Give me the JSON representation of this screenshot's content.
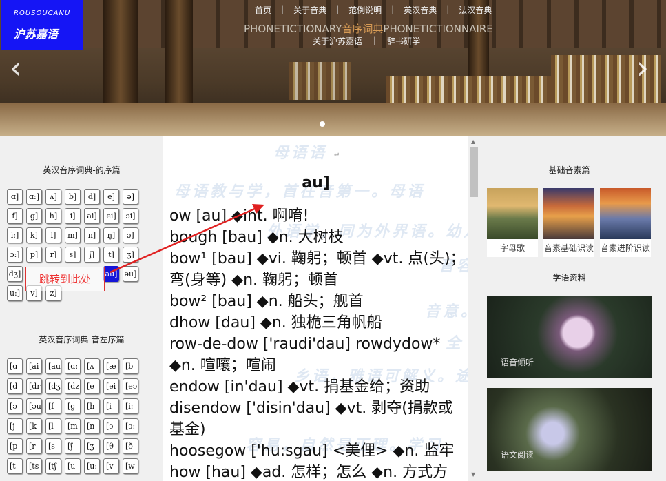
{
  "brand": {
    "en": "ROUSOUCANU",
    "cn": "沪苏嘉语"
  },
  "nav": {
    "items": [
      "首页",
      "关于音典",
      "范例说明",
      "英汉音典",
      "法汉音典"
    ],
    "separator": "|",
    "subtitle_left": "PHONETICTIONARY",
    "subtitle_mid": "音序词典",
    "subtitle_right": "PHONETICTIONNAIRE",
    "items2": [
      "关于沪苏嘉语",
      "|",
      "辞书研学"
    ]
  },
  "carousel": {
    "prev": "‹",
    "next": "›"
  },
  "left_panel": {
    "section1_title": "英汉音序词典-韵序篇",
    "rhyme_keys": [
      "ɑ]",
      "ɑ:]",
      "ʌ]",
      "b]",
      "d]",
      "e]",
      "ə]",
      "f]",
      "g]",
      "h]",
      "i]",
      "ai]",
      "ei]",
      "ɔi]",
      "i:]",
      "k]",
      "l]",
      "m]",
      "n]",
      "ŋ]",
      "ɔ]",
      "ɔ:]",
      "p]",
      "r]",
      "s]",
      "ʃ]",
      "t]",
      "ʒ]",
      "dʒ]",
      "",
      "",
      "",
      "",
      "au]",
      "əu]",
      "u:]",
      "v]",
      "z]"
    ],
    "selected_key": "au]",
    "jump_label": "跳转到此处",
    "section2_title": "英汉音序词典-音左序篇",
    "onset_keys": [
      "[ɑ",
      "[ai",
      "[au",
      "[ɑ:",
      "[ʌ",
      "[æ",
      "[b",
      "[d",
      "[dr",
      "[dʒ",
      "[dz",
      "[e",
      "[ei",
      "[eə",
      "[ə",
      "[əu",
      "[f",
      "[g",
      "[h",
      "[i",
      "[i:",
      "[j",
      "[k",
      "[l",
      "[m",
      "[n",
      "[ɔ",
      "[ɔ:",
      "[p",
      "[r",
      "[s",
      "[ʃ",
      "[ʒ",
      "[θ",
      "[ð",
      "[t",
      "[ts",
      "[tʃ",
      "[u",
      "[u:",
      "[v",
      "[w"
    ]
  },
  "center": {
    "return_mark": "↵",
    "heading": "au]",
    "entries": [
      "ow [au] ◆int. 啊唷!",
      "bough [bau] ◆n. 大树枝",
      "bow¹ [bau] ◆vi. 鞠躬；顿首 ◆vt. 点(头)；弯(身等) ◆n. 鞠躬；顿首",
      "bow² [bau] ◆n. 船头；舰首",
      "dhow [dau] ◆n. 独桅三角帆船",
      "row-de-dow ['raudi'dau] rowdydow* ◆n. 喧嚷；喧闹",
      "endow [in'dau] ◆vt. 捐基金给；资助",
      "disendow ['disin'dau] ◆vt. 剥夺(捐款或基金)",
      "hoosegow ['hu:sgau] <美俚> ◆n. 监牢",
      "how [hau] ◆ad. 怎样；怎么 ◆n. 方式方"
    ],
    "watermark_lines": [
      "母语语",
      "母语教与学，首在音第一。母语",
      "外语学，同为外界语。幼儿",
      "音容",
      "音意。天生",
      "全",
      "乡语，雅语可解义。途经",
      "容易，自然是正理。学习"
    ]
  },
  "right_panel": {
    "section1_title": "基础音素篇",
    "thumbs": [
      "字母歌",
      "音素基础识读",
      "音素进阶识读"
    ],
    "section2_title": "学语资料",
    "big_captions": [
      "语音倾听",
      "语文阅读"
    ]
  }
}
